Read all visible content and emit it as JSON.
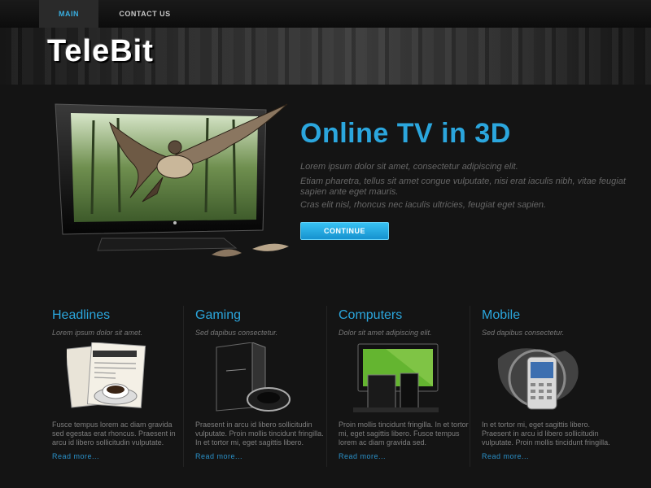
{
  "nav": {
    "items": [
      {
        "label": "MAIN",
        "active": true
      },
      {
        "label": "CONTACT US",
        "active": false
      }
    ]
  },
  "brand": {
    "logo": "TeleBit"
  },
  "hero": {
    "title": "Online TV in 3D",
    "paragraphs": [
      "Lorem ipsum dolor sit amet, consectetur adipiscing elit.",
      "Etiam pharetra, tellus sit amet congue vulputate, nisi erat iaculis nibh, vitae feugiat sapien ante eget mauris.",
      "Cras elit nisl, rhoncus nec iaculis ultricies, feugiat eget sapien."
    ],
    "button": "CONTINUE"
  },
  "columns": [
    {
      "title": "Headlines",
      "subtitle": "Lorem ipsum dolor sit amet.",
      "image": "newspaper-icon",
      "body": "Fusce tempus lorem ac diam gravida sed egestas erat rhoncus. Praesent in arcu id libero sollicitudin vulputate.",
      "link": "Read more..."
    },
    {
      "title": "Gaming",
      "subtitle": "Sed dapibus consectetur.",
      "image": "game-console-icon",
      "body": "Praesent in arcu id libero sollicitudin vulputate. Proin mollis tincidunt fringilla. In et tortor mi, eget sagittis libero.",
      "link": "Read more..."
    },
    {
      "title": "Computers",
      "subtitle": "Dolor sit amet adipiscing elit.",
      "image": "computer-icon",
      "body": "Proin mollis tincidunt fringilla. In et tortor mi, eget sagittis libero. Fusce tempus lorem ac diam gravida sed.",
      "link": "Read more..."
    },
    {
      "title": "Mobile",
      "subtitle": "Sed dapibus consectetur.",
      "image": "mobile-phone-icon",
      "body": "In et tortor mi, eget sagittis libero. Praesent in arcu id libero sollicitudin vulputate. Proin mollis tincidunt fringilla.",
      "link": "Read more..."
    }
  ],
  "colors": {
    "accent": "#2ba6dd",
    "background": "#141414",
    "button": "#1f9fd9"
  }
}
